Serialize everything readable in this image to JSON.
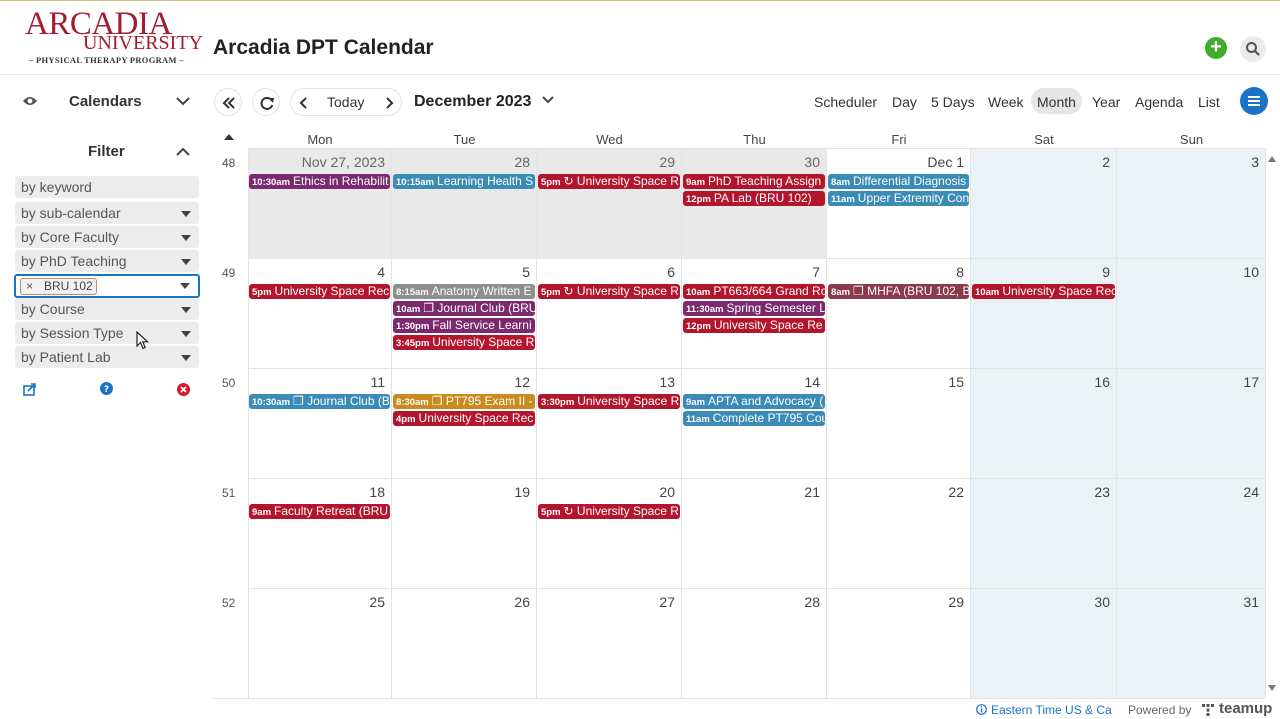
{
  "logo": {
    "line1": "ARCADIA",
    "line2": "UNIVERSITY",
    "line3": "– PHYSICAL THERAPY PROGRAM –"
  },
  "header": {
    "title": "Arcadia DPT Calendar"
  },
  "sidebar": {
    "calendars_label": "Calendars",
    "filter_label": "Filter",
    "keyword": "by keyword",
    "filters": [
      "by sub-calendar",
      "by Core Faculty",
      "by PhD Teaching"
    ],
    "active_tag": "BRU 102",
    "filters2": [
      "by Course",
      "by Session Type",
      "by Patient Lab"
    ],
    "close_icon": "×"
  },
  "toolbar": {
    "today": "Today",
    "period": "December 2023",
    "views": [
      "Scheduler",
      "Day",
      "5 Days",
      "Week",
      "Month",
      "Year",
      "Agenda",
      "List"
    ],
    "active_view": "Month"
  },
  "calendar": {
    "weekdays": [
      "Mon",
      "Tue",
      "Wed",
      "Thu",
      "Fri",
      "Sat",
      "Sun"
    ],
    "weeks": [
      {
        "num": "48",
        "days": [
          "Nov 27, 2023",
          "28",
          "29",
          "30",
          "Dec 1",
          "2",
          "3"
        ]
      },
      {
        "num": "49",
        "days": [
          "4",
          "5",
          "6",
          "7",
          "8",
          "9",
          "10"
        ]
      },
      {
        "num": "50",
        "days": [
          "11",
          "12",
          "13",
          "14",
          "15",
          "16",
          "17"
        ]
      },
      {
        "num": "51",
        "days": [
          "18",
          "19",
          "20",
          "21",
          "22",
          "23",
          "24"
        ]
      },
      {
        "num": "52",
        "days": [
          "25",
          "26",
          "27",
          "28",
          "29",
          "30",
          "31"
        ]
      }
    ],
    "events": [
      {
        "w": 0,
        "d": 0,
        "row": 0,
        "time": "10:30am",
        "title": "Ethics in Rehabilit",
        "color": "#7b2a6f"
      },
      {
        "w": 0,
        "d": 1,
        "row": 0,
        "time": "10:15am",
        "title": "Learning Health S",
        "color": "#3a8bb6"
      },
      {
        "w": 0,
        "d": 2,
        "row": 0,
        "time": "5pm",
        "title": "↻ University Space R",
        "color": "#b3162c"
      },
      {
        "w": 0,
        "d": 3,
        "row": 0,
        "time": "9am",
        "title": "PhD Teaching Assign",
        "color": "#b3162c"
      },
      {
        "w": 0,
        "d": 3,
        "row": 1,
        "time": "12pm",
        "title": "PA Lab (BRU 102)",
        "color": "#b3162c"
      },
      {
        "w": 0,
        "d": 4,
        "row": 0,
        "time": "8am",
        "title": "Differential Diagnosis",
        "color": "#3a8bb6"
      },
      {
        "w": 0,
        "d": 4,
        "row": 1,
        "time": "11am",
        "title": "Upper Extremity Con",
        "color": "#3a8bb6"
      },
      {
        "w": 1,
        "d": 0,
        "row": 0,
        "time": "5pm",
        "title": "University Space Rec",
        "color": "#b3162c"
      },
      {
        "w": 1,
        "d": 1,
        "row": 0,
        "time": "8:15am",
        "title": "Anatomy Written E",
        "color": "#8e8e8e"
      },
      {
        "w": 1,
        "d": 1,
        "row": 1,
        "time": "10am",
        "title": "❐ Journal Club (BRU",
        "color": "#7b2a6f"
      },
      {
        "w": 1,
        "d": 1,
        "row": 2,
        "time": "1:30pm",
        "title": "Fall Service Learni",
        "color": "#7b2a6f"
      },
      {
        "w": 1,
        "d": 1,
        "row": 3,
        "time": "3:45pm",
        "title": "University Space R",
        "color": "#b3162c"
      },
      {
        "w": 1,
        "d": 2,
        "row": 0,
        "time": "5pm",
        "title": "↻ University Space R",
        "color": "#b3162c"
      },
      {
        "w": 1,
        "d": 3,
        "row": 0,
        "time": "10am",
        "title": "PT663/664 Grand Ro",
        "color": "#b3162c"
      },
      {
        "w": 1,
        "d": 3,
        "row": 1,
        "time": "11:30am",
        "title": "Spring Semester L",
        "color": "#7b2a6f"
      },
      {
        "w": 1,
        "d": 3,
        "row": 2,
        "time": "12pm",
        "title": "University Space Re",
        "color": "#b3162c"
      },
      {
        "w": 1,
        "d": 4,
        "row": 0,
        "time": "8am",
        "title": "❐ MHFA (BRU 102, B",
        "color": "#8a3a4a"
      },
      {
        "w": 1,
        "d": 5,
        "row": 0,
        "time": "10am",
        "title": "University Space Rec",
        "color": "#b3162c"
      },
      {
        "w": 2,
        "d": 0,
        "row": 0,
        "time": "10:30am",
        "title": "❐ Journal Club (B",
        "color": "#3a8bb6"
      },
      {
        "w": 2,
        "d": 1,
        "row": 0,
        "time": "8:30am",
        "title": "❐ PT795 Exam II -",
        "color": "#c98a1e"
      },
      {
        "w": 2,
        "d": 1,
        "row": 1,
        "time": "4pm",
        "title": "University Space Rec",
        "color": "#b3162c"
      },
      {
        "w": 2,
        "d": 2,
        "row": 0,
        "time": "3:30pm",
        "title": "University Space R",
        "color": "#b3162c"
      },
      {
        "w": 2,
        "d": 3,
        "row": 0,
        "time": "9am",
        "title": "APTA and Advocacy (",
        "color": "#3a8bb6"
      },
      {
        "w": 2,
        "d": 3,
        "row": 1,
        "time": "11am",
        "title": "Complete PT795 Cou",
        "color": "#3a8bb6"
      },
      {
        "w": 3,
        "d": 0,
        "row": 0,
        "time": "9am",
        "title": "Faculty Retreat (BRU",
        "color": "#b3162c"
      },
      {
        "w": 3,
        "d": 2,
        "row": 0,
        "time": "5pm",
        "title": "↻ University Space R",
        "color": "#b3162c"
      }
    ]
  },
  "footer": {
    "timezone": "Eastern Time US & Ca",
    "powered": "Powered by",
    "brand": "teamup"
  },
  "colors": {
    "accent": "#1a73c6",
    "add": "#3fae2a",
    "brand_red": "#a51c30"
  }
}
